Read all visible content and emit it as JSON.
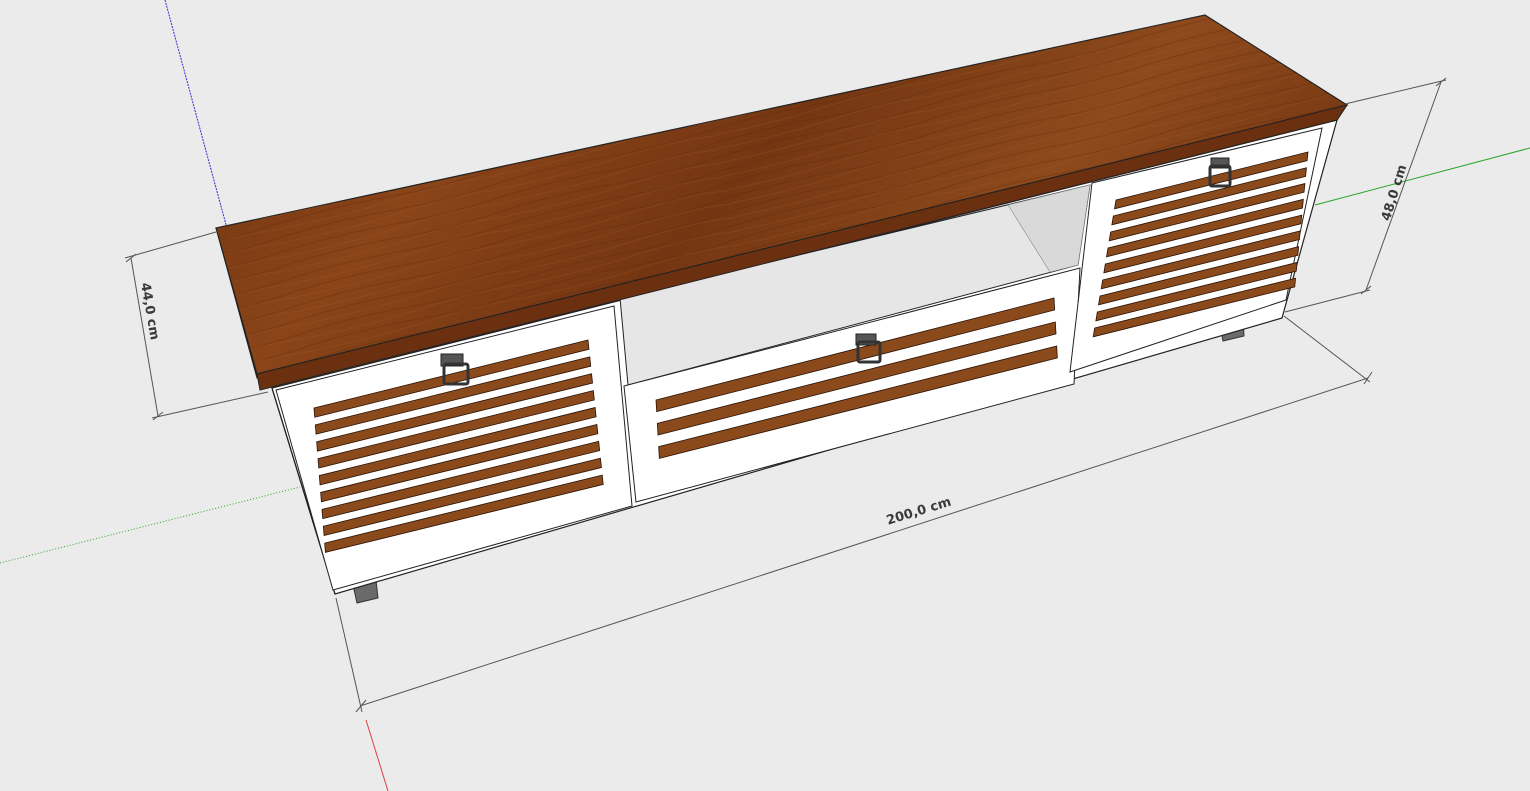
{
  "viewport": {
    "background": "#ebebeb",
    "axis_colors": {
      "red": "#e04040",
      "green": "#2aa52a",
      "blue": "#3030d0"
    }
  },
  "model": {
    "top_color": "#7a3a14",
    "top_edge_color": "#5e2a0c",
    "body_color": "#ffffff",
    "interior_color": "#e6e6e6",
    "slat_color": "#8a4a1c",
    "foot_color": "#6a6a6a"
  },
  "dimensions": {
    "width": "200,0 cm",
    "height": "44,0 cm",
    "depth": "48,0 cm"
  }
}
